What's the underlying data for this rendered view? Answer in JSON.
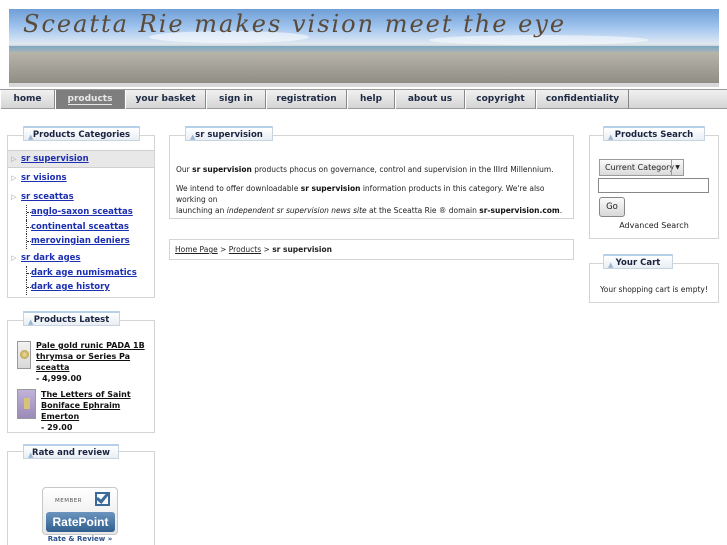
{
  "banner": {
    "title": "Sceatta Rie makes vision meet the eye"
  },
  "nav": {
    "items": [
      {
        "label": "home"
      },
      {
        "label": "products"
      },
      {
        "label": "your basket"
      },
      {
        "label": "sign in"
      },
      {
        "label": "registration"
      },
      {
        "label": "help"
      },
      {
        "label": "about us"
      },
      {
        "label": "copyright"
      },
      {
        "label": "confidentiality"
      }
    ]
  },
  "categories": {
    "heading": "Products  Categories",
    "items": [
      {
        "label": "sr supervision"
      },
      {
        "label": "sr visions"
      },
      {
        "label": "sr sceattas"
      },
      {
        "label": "anglo-saxon sceattas"
      },
      {
        "label": "continental sceattas"
      },
      {
        "label": "merovingian deniers"
      },
      {
        "label": "sr dark ages"
      },
      {
        "label": "dark age numismatics"
      },
      {
        "label": "dark age history"
      }
    ]
  },
  "latest": {
    "heading": "Products  Latest",
    "items": [
      {
        "name_line1": "Pale gold runic PADA 1B",
        "name_line2": "thrymsa or Series Pa sceatta",
        "price": "- 4,999.00"
      },
      {
        "name_line1": "The Letters of Saint",
        "name_line2": "Boniface Ephraim Emerton",
        "price": "- 29.00"
      }
    ]
  },
  "rate": {
    "heading": "Rate and review",
    "badge_member": "MEMBER",
    "badge_brand": "RatePoint",
    "badge_link": "Rate & Review »"
  },
  "content": {
    "heading": "sr supervision",
    "p1_a": "Our ",
    "p1_b": "sr supervision",
    "p1_c": " products phocus on governance, control and supervision in the IIIrd Millennium.",
    "p2_a": "We intend to offer downloadable ",
    "p2_b": "sr supervision",
    "p2_c": " information products in this category. We're also working on",
    "p3_a": "launching an ",
    "p3_b": "independent sr supervision news site",
    "p3_c": " at the Sceatta Rie ® domain ",
    "p3_d": "sr-supervision.com",
    "p3_e": "."
  },
  "breadcrumb": {
    "home": "Home Page",
    "sep1": " > ",
    "products": "Products",
    "sep2": " > ",
    "current": "sr supervision"
  },
  "search": {
    "heading": "Products  Search",
    "select_value": "Current Category",
    "go_label": "Go",
    "advanced": "Advanced Search"
  },
  "cart": {
    "heading": "Your Cart",
    "empty": "Your shopping cart is empty!"
  },
  "colors": {
    "link": "#1c2fb0",
    "nav_active": "#7e7e7e",
    "box_border": "#d4d4d4"
  }
}
